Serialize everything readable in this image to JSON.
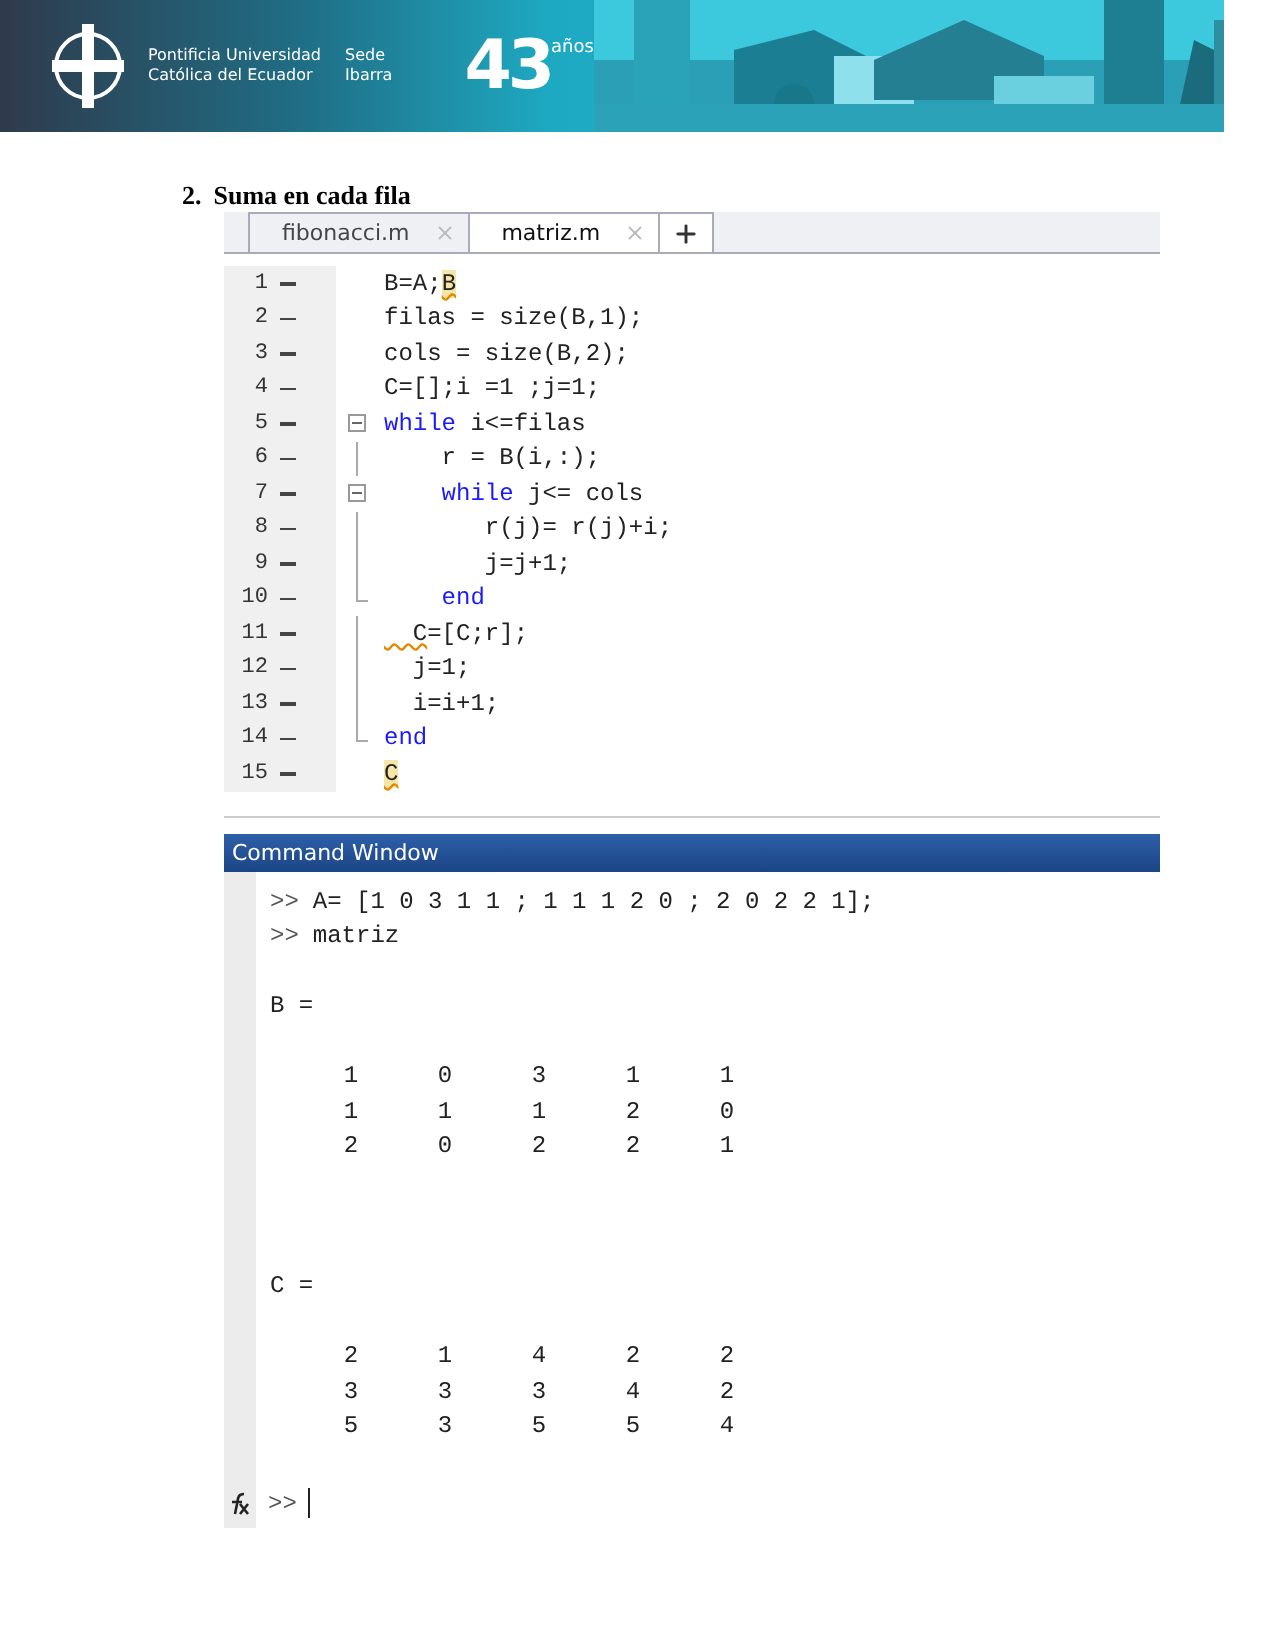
{
  "banner": {
    "institution": [
      "Pontificia Universidad",
      "Católica del Ecuador"
    ],
    "campus": [
      "Sede",
      "Ibarra"
    ],
    "anniversary": {
      "number": "43",
      "unit": "años"
    }
  },
  "heading": {
    "number": "2.",
    "text": "Suma en cada fila"
  },
  "editor": {
    "tabs": [
      {
        "label": "fibonacci.m",
        "selected": false
      },
      {
        "label": "matriz.m",
        "selected": true
      }
    ],
    "lines": [
      {
        "number": "1",
        "kind": "plain",
        "segments": [
          {
            "kind": "plain",
            "text": "B=A;"
          },
          {
            "kind": "highlight",
            "text": "B"
          }
        ]
      },
      {
        "number": "2",
        "kind": "plain",
        "segments": [
          {
            "kind": "plain",
            "text": "filas = size(B,1);"
          }
        ]
      },
      {
        "number": "3",
        "kind": "plain",
        "segments": [
          {
            "kind": "plain",
            "text": "cols = size(B,2);"
          }
        ]
      },
      {
        "number": "4",
        "kind": "plain",
        "segments": [
          {
            "kind": "plain",
            "text": "C=[];i =1 ;j=1;"
          }
        ]
      },
      {
        "number": "5",
        "kind": "fold_start",
        "segments": [
          {
            "kind": "keyword",
            "text": "while"
          },
          {
            "kind": "plain",
            "text": " i<=filas"
          }
        ]
      },
      {
        "number": "6",
        "kind": "fold_body",
        "segments": [
          {
            "kind": "plain",
            "text": "    r = B(i,:);"
          }
        ]
      },
      {
        "number": "7",
        "kind": "fold_start",
        "segments": [
          {
            "kind": "keyword",
            "text": "    while"
          },
          {
            "kind": "plain",
            "text": " j<= cols"
          }
        ]
      },
      {
        "number": "8",
        "kind": "fold_body",
        "segments": [
          {
            "kind": "plain",
            "text": "       r(j)= r(j)+i;"
          }
        ]
      },
      {
        "number": "9",
        "kind": "fold_body",
        "segments": [
          {
            "kind": "plain",
            "text": "       j=j+1;"
          }
        ]
      },
      {
        "number": "10",
        "kind": "fold_end",
        "segments": [
          {
            "kind": "keyword",
            "text": "    end"
          }
        ]
      },
      {
        "number": "11",
        "kind": "fold_body",
        "segments": [
          {
            "kind": "warning",
            "text": "  C"
          },
          {
            "kind": "plain",
            "text": "=[C;r];"
          }
        ]
      },
      {
        "number": "12",
        "kind": "fold_body",
        "segments": [
          {
            "kind": "plain",
            "text": "  j=1;"
          }
        ]
      },
      {
        "number": "13",
        "kind": "fold_body",
        "segments": [
          {
            "kind": "plain",
            "text": "  i=i+1;"
          }
        ]
      },
      {
        "number": "14",
        "kind": "fold_end",
        "segments": [
          {
            "kind": "keyword",
            "text": "end"
          }
        ]
      },
      {
        "number": "15",
        "kind": "plain",
        "segments": [
          {
            "kind": "highlight",
            "text": "C"
          }
        ]
      }
    ]
  },
  "command_window": {
    "title": "Command Window",
    "lines": [
      {
        "kind": "command",
        "prompt": ">>",
        "text": "A= [1 0 3 1 1 ; 1 1 1 2 0 ; 2 0 2 2 1];"
      },
      {
        "kind": "command",
        "prompt": ">>",
        "text": "matriz"
      },
      {
        "kind": "blank"
      },
      {
        "kind": "output",
        "text": "B ="
      },
      {
        "kind": "blank"
      },
      {
        "kind": "matrix",
        "values": [
          "1",
          "0",
          "3",
          "1",
          "1"
        ]
      },
      {
        "kind": "matrix",
        "values": [
          "1",
          "1",
          "1",
          "2",
          "0"
        ]
      },
      {
        "kind": "matrix",
        "values": [
          "2",
          "0",
          "2",
          "2",
          "1"
        ]
      },
      {
        "kind": "blank"
      },
      {
        "kind": "blank"
      },
      {
        "kind": "blank"
      },
      {
        "kind": "output",
        "text": "C ="
      },
      {
        "kind": "blank"
      },
      {
        "kind": "matrix",
        "values": [
          "2",
          "1",
          "4",
          "2",
          "2"
        ]
      },
      {
        "kind": "matrix",
        "values": [
          "3",
          "3",
          "3",
          "4",
          "2"
        ]
      },
      {
        "kind": "matrix",
        "values": [
          "5",
          "3",
          "5",
          "5",
          "4"
        ]
      },
      {
        "kind": "blank"
      }
    ],
    "input": {
      "prompt": ">>"
    }
  }
}
